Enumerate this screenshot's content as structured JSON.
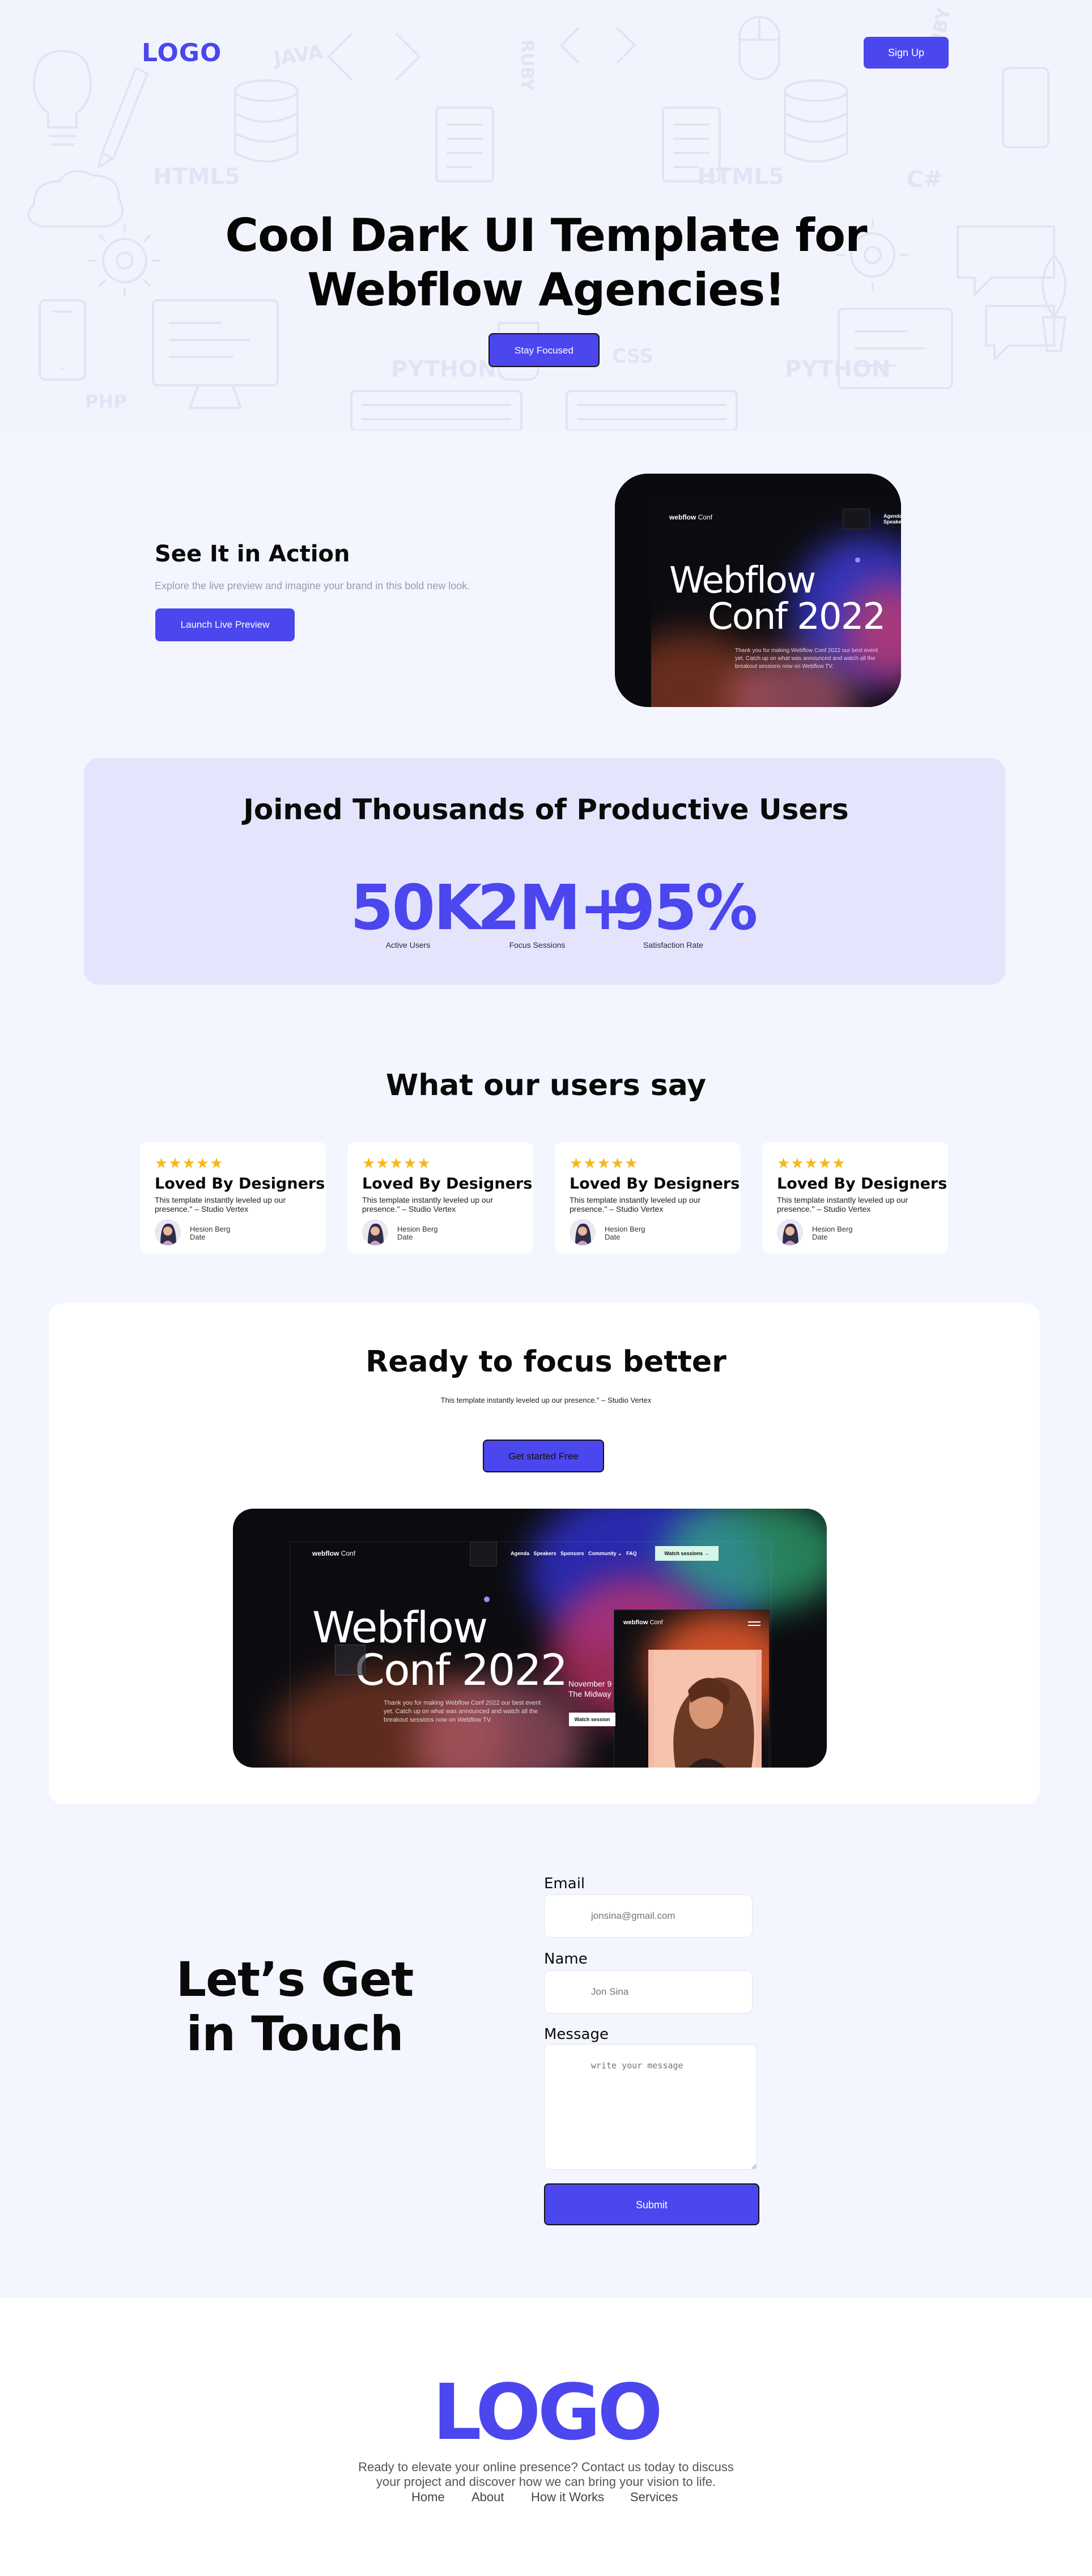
{
  "header": {
    "logo": "LOGO",
    "signup_label": "Sign Up"
  },
  "hero": {
    "title_line1": "Cool Dark UI Template for",
    "title_line2": "Webflow Agencies!",
    "cta_label": "Stay Focused",
    "doodle_words": [
      "JAVA",
      "RUBY",
      "HTML5",
      "PYTHON",
      "PHP",
      "CSS",
      "C#",
      "HTML5",
      "PYTHON",
      "RUBY"
    ]
  },
  "action": {
    "title": "See It in Action",
    "subtitle": "Explore the live preview and imagine your brand in this bold new look.",
    "cta_label": "Launch Live Preview"
  },
  "preview_small": {
    "brand": "webflow",
    "brand_suffix": "Conf",
    "nav": [
      "Agenda",
      "Speakers"
    ],
    "headline1": "Webflow",
    "headline2": "Conf 2022",
    "para": "Thank you for making Webflow Conf 2022 our best event yet. Catch up on what was announced and watch all the breakout sessions now on Webflow TV."
  },
  "stats": {
    "title": "Joined Thousands of Productive Users",
    "items": [
      {
        "value": "50K",
        "label": "Active Users"
      },
      {
        "value": "2M+",
        "label": "Focus Sessions"
      },
      {
        "value": "95%",
        "label": "Satisfaction Rate"
      }
    ]
  },
  "testimonials": {
    "title": "What our users say",
    "items": [
      {
        "stars": "★★★★★",
        "title": "Loved By Designers",
        "quote": "This template instantly leveled up our presence.\" – Studio Vertex",
        "name": "Hesion Berg",
        "date": "Date"
      },
      {
        "stars": "★★★★★",
        "title": "Loved By Designers",
        "quote": "This template instantly leveled up our presence.\" – Studio Vertex",
        "name": "Hesion Berg",
        "date": "Date"
      },
      {
        "stars": "★★★★★",
        "title": "Loved By Designers",
        "quote": "This template instantly leveled up our presence.\" – Studio Vertex",
        "name": "Hesion Berg",
        "date": "Date"
      },
      {
        "stars": "★★★★★",
        "title": "Loved By Designers",
        "quote": "This template instantly leveled up our presence.\" – Studio Vertex",
        "name": "Hesion Berg",
        "date": "Date"
      }
    ]
  },
  "ready": {
    "title": "Ready to focus better",
    "subtitle": "This template instantly leveled up our presence.\" – Studio Vertex",
    "cta_label": "Get started Free"
  },
  "preview_large": {
    "brand": "webflow",
    "brand_suffix": "Conf",
    "nav": [
      "Agenda",
      "Speakers",
      "Sponsors",
      "Community ⌄",
      "FAQ"
    ],
    "watch_label": "Watch sessions  →",
    "headline1": "Webflow",
    "headline2": "Conf 2022",
    "para": "Thank you for making Webflow Conf 2022 our best event yet. Catch up on what was announced and watch all the breakout sessions now on Webflow TV.",
    "mobile_brand": "webflow",
    "mobile_suffix": "Conf",
    "date_text1": "November 9",
    "date_text2": "The Midway",
    "watch_small": "Watch session"
  },
  "contact": {
    "title_line1": "Let’s Get",
    "title_line2": "in Touch",
    "email_label": "Email",
    "email_placeholder": "jonsina@gmail.com",
    "name_label": "Name",
    "name_placeholder": "Jon Sina",
    "message_label": "Message",
    "message_placeholder": "write your message",
    "submit_label": "Submit"
  },
  "footer": {
    "logo": "LOGO",
    "text_line1": "Ready to elevate your online presence? Contact us today to discuss",
    "text_line2": "your project and discover how we can bring your vision to life.",
    "nav": [
      "Home",
      "About",
      "How it Works",
      "Services"
    ]
  },
  "colors": {
    "accent": "#4b46ee",
    "stars": "#f5b81b",
    "page_bg": "#f3f5ff",
    "stats_bg": "#e4e5fd"
  }
}
